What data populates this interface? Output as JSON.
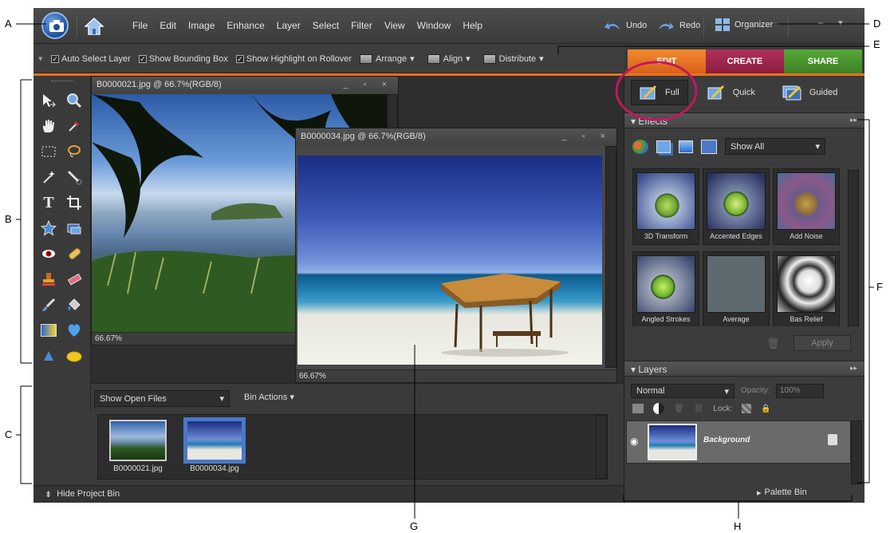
{
  "menubar": {
    "items": [
      "File",
      "Edit",
      "Image",
      "Enhance",
      "Layer",
      "Select",
      "Filter",
      "View",
      "Window",
      "Help"
    ],
    "undo_label": "Undo",
    "redo_label": "Redo",
    "organizer_label": "Organizer"
  },
  "options_bar": {
    "auto_select": "Auto Select Layer",
    "show_bounding": "Show Bounding Box",
    "show_highlight": "Show Highlight on Rollover",
    "arrange": "Arrange",
    "align": "Align",
    "distribute": "Distribute"
  },
  "tabs": {
    "edit": "EDIT",
    "create": "CREATE",
    "share": "SHARE"
  },
  "documents": [
    {
      "title": "B0000021.jpg @ 66.7%(RGB/8)",
      "zoom": "66.67%"
    },
    {
      "title": "B0000034.jpg @ 66.7%(RGB/8)",
      "zoom": "66.67%"
    }
  ],
  "project_bin": {
    "show_select": "Show Open Files",
    "bin_actions": "Bin Actions",
    "thumbs": [
      {
        "label": "B0000021.jpg"
      },
      {
        "label": "B0000034.jpg"
      }
    ],
    "hide_label": "Hide Project Bin"
  },
  "modes": {
    "full": "Full",
    "quick": "Quick",
    "guided": "Guided"
  },
  "effects_panel": {
    "title": "Effects",
    "filter_select": "Show All",
    "items": [
      {
        "label": "3D Transform"
      },
      {
        "label": "Accented Edges"
      },
      {
        "label": "Add Noise"
      },
      {
        "label": "Angled Strokes"
      },
      {
        "label": "Average"
      },
      {
        "label": "Bas Relief"
      }
    ],
    "apply": "Apply"
  },
  "layers_panel": {
    "title": "Layers",
    "blend": "Normal",
    "opacity_label": "Opacity:",
    "opacity_value": "100%",
    "lock_label": "Lock:",
    "layer_name": "Background"
  },
  "palette_bin": "Palette Bin",
  "callouts": {
    "A": "A",
    "B": "B",
    "C": "C",
    "D": "D",
    "E": "E",
    "F": "F",
    "G": "G",
    "H": "H"
  }
}
